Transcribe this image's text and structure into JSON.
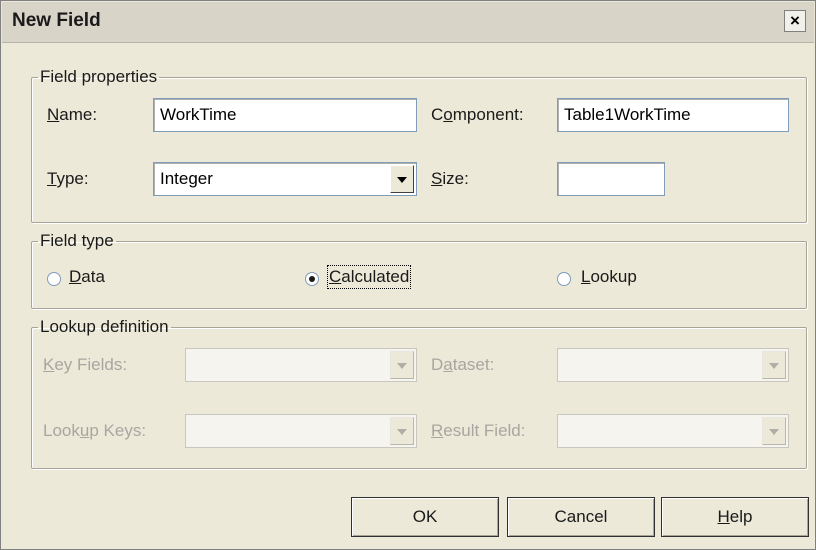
{
  "window": {
    "title": "New Field",
    "close_glyph": "×"
  },
  "field_properties": {
    "legend": "Field properties",
    "name_label": "Name:",
    "name_value": "WorkTime",
    "component_label": "Component:",
    "component_value": "Table1WorkTime",
    "type_label": "Type:",
    "type_value": "Integer",
    "size_label": "Size:",
    "size_value": ""
  },
  "field_type": {
    "legend": "Field type",
    "options": [
      "Data",
      "Calculated",
      "Lookup"
    ],
    "selected": "Calculated"
  },
  "lookup_definition": {
    "legend": "Lookup definition",
    "key_fields_label": "Key Fields:",
    "dataset_label": "Dataset:",
    "lookup_keys_label": "Lookup Keys:",
    "result_field_label": "Result Field:"
  },
  "buttons": {
    "ok": "OK",
    "cancel": "Cancel",
    "help": "Help"
  },
  "icons": {
    "close": "close-icon",
    "dropdown": "chevron-down-icon"
  }
}
